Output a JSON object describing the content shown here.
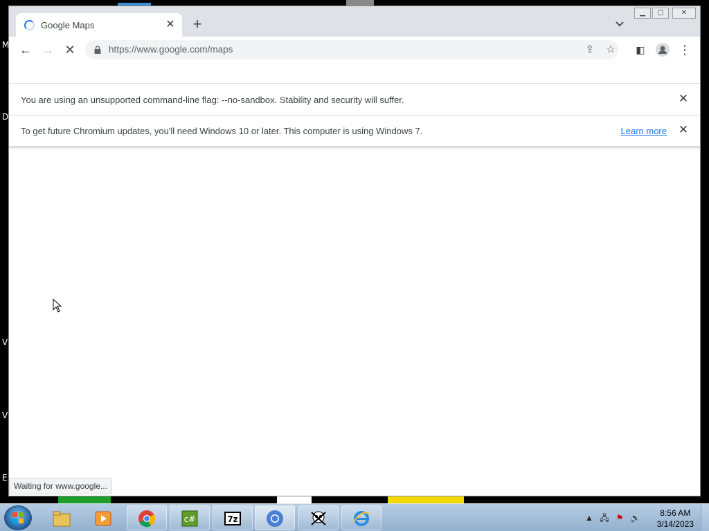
{
  "browser": {
    "tab": {
      "title": "Google Maps"
    },
    "address_bar": {
      "url": "https://www.google.com/maps"
    },
    "window_controls": [
      "minimize",
      "maximize",
      "close"
    ]
  },
  "infobars": [
    {
      "message": "You are using an unsupported command-line flag: --no-sandbox. Stability and security will suffer."
    },
    {
      "message": "To get future Chromium updates, you'll need Windows 10 or later. This computer is using Windows 7.",
      "link": "Learn more"
    }
  ],
  "status_bubble": "Waiting for www.google...",
  "taskbar": {
    "apps": [
      "Windows Explorer",
      "Windows Media Player",
      "Google Chrome",
      "C# Editor",
      "7-Zip",
      "Chromium",
      "Pirate App",
      "Internet Explorer"
    ],
    "clock": {
      "time": "8:56 AM",
      "date": "3/14/2023"
    }
  },
  "desktop_letters": [
    "M",
    "D",
    "V",
    "V",
    "E"
  ],
  "colors": {
    "accent": "#1a73e8",
    "taskbar": "#a8c2dc",
    "tabstrip": "#dee1e6"
  }
}
